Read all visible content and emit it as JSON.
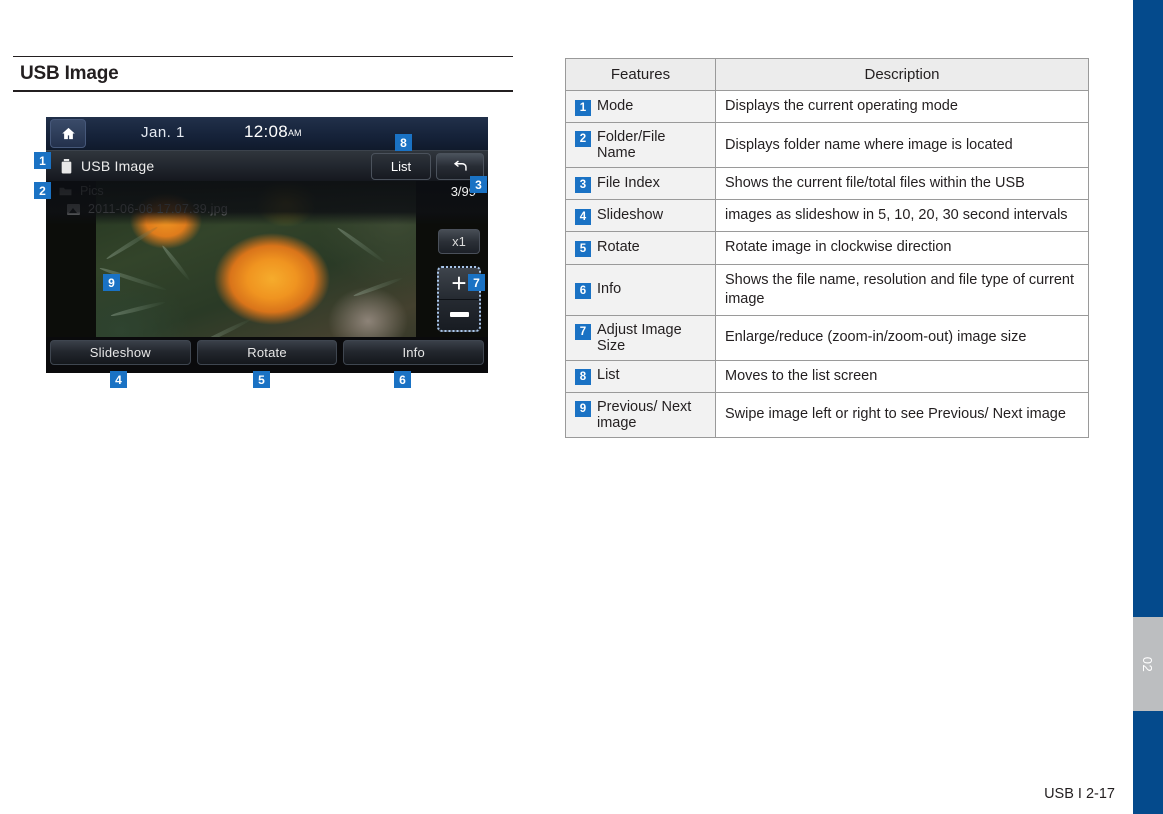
{
  "page_title": "USB Image",
  "footer": "USB I 2-17",
  "side_tab_label": "02",
  "colors": {
    "accent_blue": "#044a8c",
    "badge_blue": "#1a72c4",
    "tab_gray": "#bcbec0",
    "table_header_bg": "#ececec",
    "table_feature_bg": "#f2f2f2",
    "text": "#231f20"
  },
  "device": {
    "status": {
      "home_icon": "home-icon",
      "date": "Jan.  1",
      "time": "12:08",
      "ampm": "AM"
    },
    "mode_bar": {
      "usb_icon": "usb-drive-icon",
      "mode_label": "USB Image",
      "list_button": "List",
      "back_icon": "back-arrow-icon"
    },
    "file_info": {
      "folder_icon": "folder-icon",
      "folder_name": "Pics",
      "file_icon": "picture-file-icon",
      "file_name": "2011-06-06 17.07.39.jpg",
      "file_index": "3/99"
    },
    "zoom": {
      "level_label": "x1",
      "zoom_in_icon": "plus-icon",
      "zoom_out_icon": "minus-icon"
    },
    "soft_buttons": [
      {
        "label": "Slideshow"
      },
      {
        "label": "Rotate"
      },
      {
        "label": "Info"
      }
    ]
  },
  "callouts": [
    {
      "num": "1",
      "target": "mode"
    },
    {
      "num": "2",
      "target": "folder-file-name"
    },
    {
      "num": "3",
      "target": "file-index"
    },
    {
      "num": "4",
      "target": "slideshow"
    },
    {
      "num": "5",
      "target": "rotate"
    },
    {
      "num": "6",
      "target": "info"
    },
    {
      "num": "7",
      "target": "adjust-image-size"
    },
    {
      "num": "8",
      "target": "list"
    },
    {
      "num": "9",
      "target": "previous-next-image"
    }
  ],
  "table": {
    "headers": [
      "Features",
      "Description"
    ],
    "rows": [
      {
        "num": "1",
        "feature": "Mode",
        "description": "Displays the current operating mode"
      },
      {
        "num": "2",
        "feature": "Folder/File Name",
        "description": "Displays folder name where image is located"
      },
      {
        "num": "3",
        "feature": "File Index",
        "description": "Shows the current file/total files within the USB"
      },
      {
        "num": "4",
        "feature": "Slideshow",
        "description": "images as slideshow in 5, 10, 20, 30 second intervals"
      },
      {
        "num": "5",
        "feature": "Rotate",
        "description": "Rotate image in clockwise direction"
      },
      {
        "num": "6",
        "feature": "Info",
        "description": "Shows the file name, resolution and file type of current image"
      },
      {
        "num": "7",
        "feature": "Adjust Image Size",
        "description": "Enlarge/reduce (zoom-in/zoom-out) image size"
      },
      {
        "num": "8",
        "feature": "List",
        "description": "Moves to the list screen"
      },
      {
        "num": "9",
        "feature": "Previous/ Next image",
        "description": "Swipe image left or right to see Previous/ Next image"
      }
    ]
  }
}
